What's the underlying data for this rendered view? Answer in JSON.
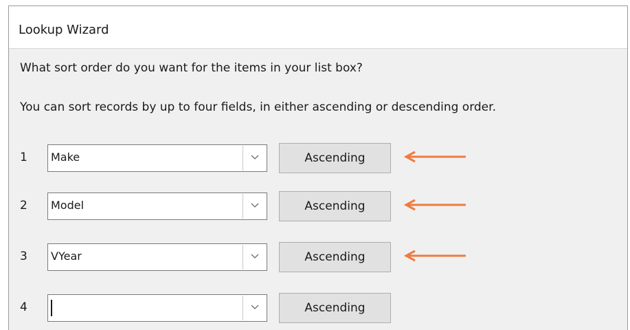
{
  "window": {
    "title": "Lookup Wizard"
  },
  "wizard": {
    "question": "What sort order do you want for the items in your list box?",
    "instruction": "You can sort records by up to four fields, in either ascending or descending order."
  },
  "sort_rows": [
    {
      "number": "1",
      "field": "Make",
      "order": "Ascending",
      "highlighted": true
    },
    {
      "number": "2",
      "field": "Model",
      "order": "Ascending",
      "highlighted": true
    },
    {
      "number": "3",
      "field": "VYear",
      "order": "Ascending",
      "highlighted": true
    },
    {
      "number": "4",
      "field": "",
      "order": "Ascending",
      "highlighted": false,
      "has_text_cursor": true
    }
  ],
  "colors": {
    "annotation_arrow": "#ee7b42",
    "dialog_background": "#f0f0f0",
    "button_background": "#e1e1e1"
  },
  "icons": {
    "dropdown": "chevron-down-icon",
    "annotation": "arrow-left-icon"
  }
}
